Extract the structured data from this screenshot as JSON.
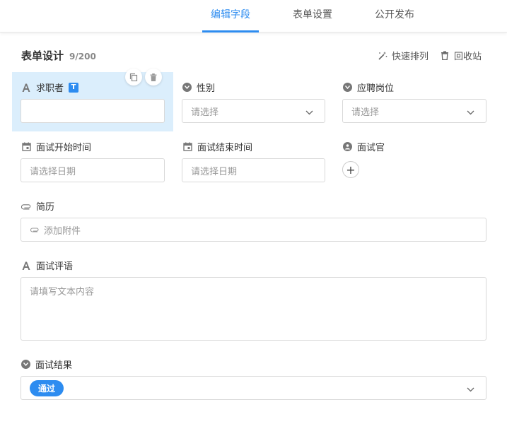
{
  "tabs": [
    {
      "label": "编辑字段",
      "active": true
    },
    {
      "label": "表单设置",
      "active": false
    },
    {
      "label": "公开发布",
      "active": false
    }
  ],
  "header": {
    "title": "表单设计",
    "count": "9/200"
  },
  "tools": {
    "auto_arrange": "快速排列",
    "recycle_bin": "回收站"
  },
  "fields": {
    "applicant": {
      "label": "求职者",
      "badge": "T",
      "value": ""
    },
    "gender": {
      "label": "性别",
      "placeholder": "请选择"
    },
    "position": {
      "label": "应聘岗位",
      "placeholder": "请选择"
    },
    "start_time": {
      "label": "面试开始时间",
      "placeholder": "请选择日期"
    },
    "end_time": {
      "label": "面试结束时间",
      "placeholder": "请选择日期"
    },
    "interviewer": {
      "label": "面试官",
      "add": "+"
    },
    "resume": {
      "label": "简历",
      "placeholder": "添加附件"
    },
    "comment": {
      "label": "面试评语",
      "placeholder": "请填写文本内容"
    },
    "result": {
      "label": "面试结果",
      "value": "通过"
    }
  },
  "colors": {
    "accent": "#2d8cf0",
    "selected_bg": "#dbeefc"
  }
}
